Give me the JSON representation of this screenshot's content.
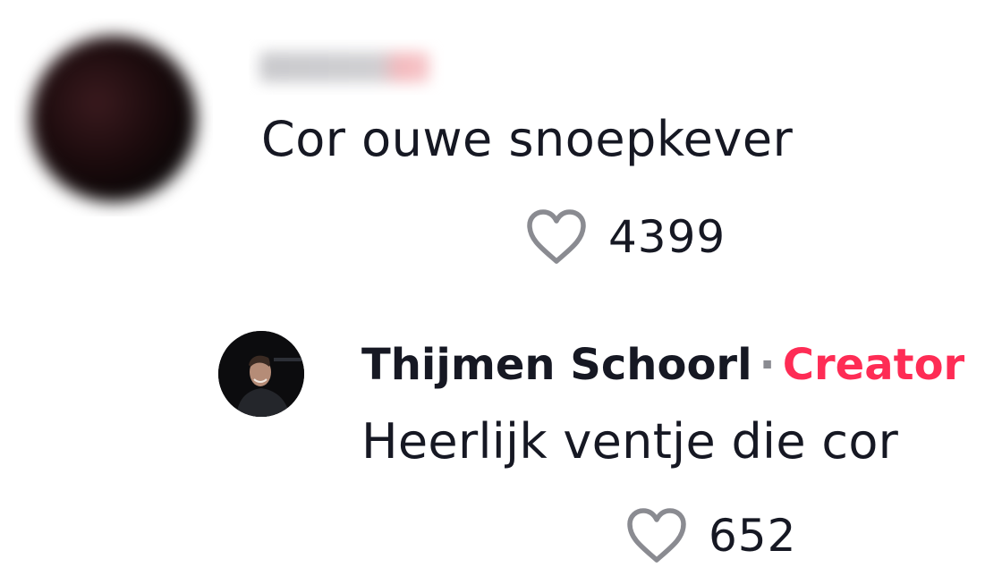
{
  "comment": {
    "username": "",
    "text": "Cor ouwe snoepkever",
    "likes": "4399"
  },
  "reply": {
    "author": "Thijmen Schoorl",
    "separator": "·",
    "badge": "Creator",
    "text": "Heerlijk ventje die cor",
    "likes": "652"
  },
  "colors": {
    "text": "#161823",
    "creator_badge": "#fe2c55",
    "heart_outline": "#8a8b91"
  },
  "icons": {
    "like": "heart-outline-icon"
  }
}
